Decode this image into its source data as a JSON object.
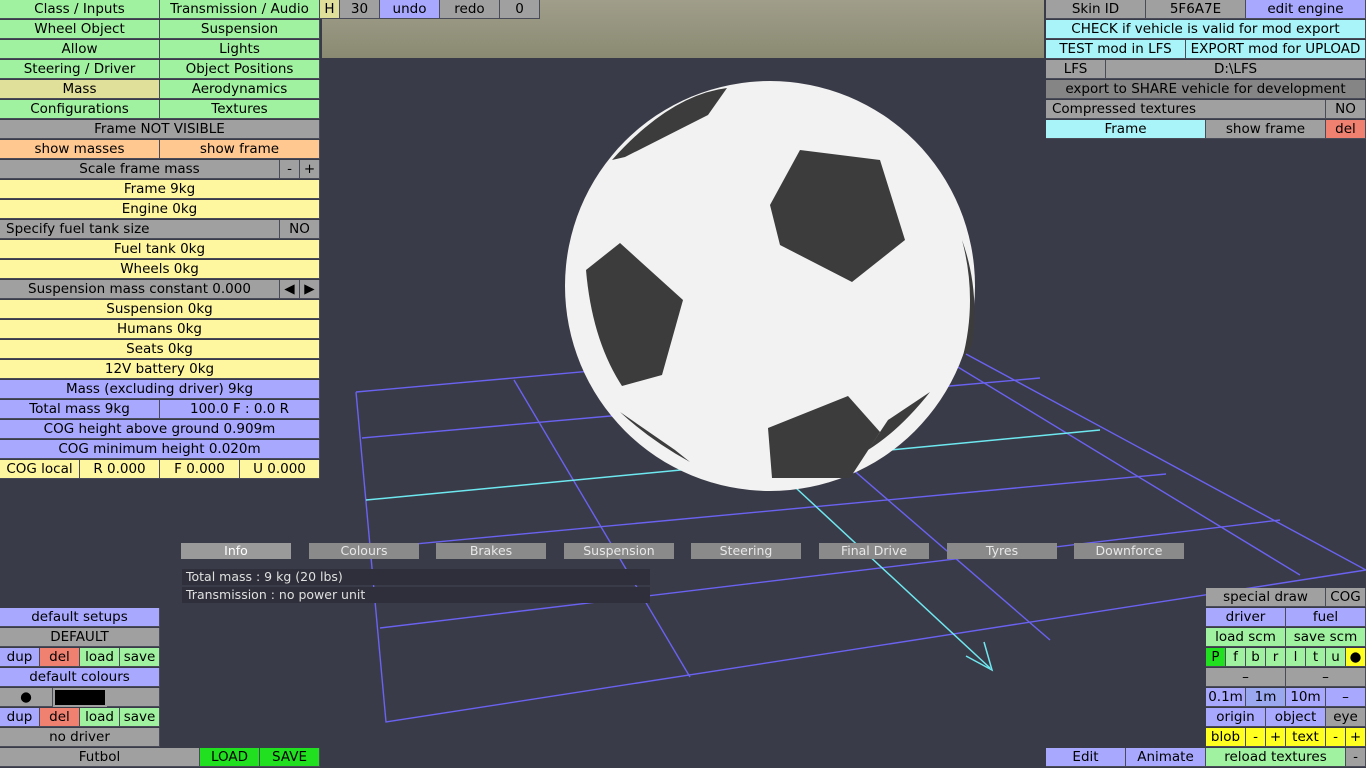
{
  "top_toolbar": {
    "h": "H",
    "num": "30",
    "undo": "undo",
    "redo": "redo",
    "zero": "0"
  },
  "left_panel": {
    "class_inputs": "Class / Inputs",
    "transmission": "Transmission / Audio",
    "wheel_object": "Wheel Object",
    "suspension": "Suspension",
    "allow": "Allow",
    "lights": "Lights",
    "steering": "Steering / Driver",
    "object_positions": "Object Positions",
    "mass": "Mass",
    "aerodynamics": "Aerodynamics",
    "configurations": "Configurations",
    "textures": "Textures",
    "frame_not_visible": "Frame NOT VISIBLE",
    "show_masses": "show masses",
    "show_frame": "show frame",
    "scale_frame_mass": "Scale frame mass",
    "minus": "-",
    "plus": "+",
    "frame": "Frame 9kg",
    "engine": "Engine 0kg",
    "specify_fuel": "Specify fuel tank size",
    "fuel_no": "NO",
    "fuel_tank": "Fuel tank 0kg",
    "wheels": "Wheels 0kg",
    "susp_mass": "Suspension mass constant 0.000",
    "left_arrow": "◀",
    "right_arrow": "▶",
    "suspension_mass": "Suspension 0kg",
    "humans": "Humans 0kg",
    "seats": "Seats 0kg",
    "battery": "12V battery 0kg",
    "mass_excl": "Mass (excluding driver) 9kg",
    "total_mass": "Total mass 9kg",
    "distribution": "100.0 F : 0.0 R",
    "cog_height": "COG height above ground 0.909m",
    "cog_min": "COG minimum height 0.020m",
    "cog_local": "COG local",
    "cog_r": "R 0.000",
    "cog_f": "F 0.000",
    "cog_u": "U 0.000"
  },
  "top_right": {
    "skin_id": "Skin ID",
    "skin_val": "5F6A7E",
    "edit_engine": "edit engine",
    "check": "CHECK if vehicle is valid for mod export",
    "test_mod": "TEST mod in LFS",
    "export_mod": "EXPORT mod for UPLOAD",
    "lfs": "LFS",
    "path": "D:\\LFS",
    "export_share": "export to SHARE vehicle for development",
    "compressed": "Compressed textures",
    "compressed_val": "NO",
    "frame": "Frame",
    "show_frame": "show frame",
    "del": "del"
  },
  "tabs": [
    "Info",
    "Colours",
    "Brakes",
    "Suspension",
    "Steering",
    "Final Drive",
    "Tyres",
    "Downforce"
  ],
  "info_lines": [
    "Total mass : 9 kg (20 lbs)",
    "Transmission : no power unit"
  ],
  "bottom_left": {
    "default_setups": "default setups",
    "default": "DEFAULT",
    "dup": "dup",
    "del": "del",
    "load": "load",
    "save": "save",
    "default_colours": "default colours",
    "dot": "●",
    "no_driver": "no driver",
    "name": "Futbol",
    "load_caps": "LOAD",
    "save_caps": "SAVE"
  },
  "bottom_right": {
    "special_draw": "special draw",
    "cog": "COG",
    "driver": "driver",
    "fuel": "fuel",
    "load_scm": "load scm",
    "save_scm": "save scm",
    "letters": [
      "P",
      "f",
      "b",
      "r",
      "l",
      "t",
      "u",
      "●"
    ],
    "dash": "–",
    "d01": "0.1m",
    "d1": "1m",
    "d10": "10m",
    "dash2": "–",
    "origin": "origin",
    "object": "object",
    "eye": "eye",
    "blob": "blob",
    "minus": "-",
    "plus": "+",
    "text": "text",
    "edit": "Edit",
    "animate": "Animate",
    "reload": "reload textures"
  }
}
